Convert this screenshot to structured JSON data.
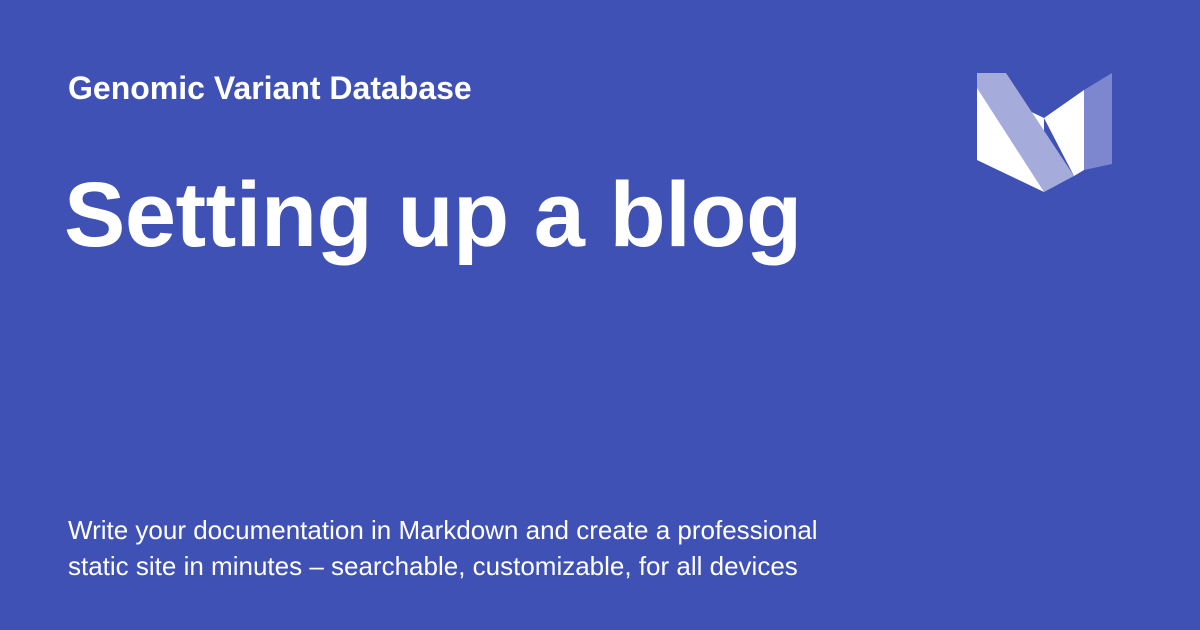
{
  "theme": {
    "background": "#3f51b5",
    "text": "#ffffff",
    "logo_light": "#ffffff",
    "logo_mid": "#a5acdc",
    "logo_dark": "#7c87cf"
  },
  "header": {
    "site_name": "Genomic Variant Database"
  },
  "main": {
    "title": "Setting up a blog"
  },
  "footer": {
    "description_line1": "Write your documentation in Markdown and create a professional",
    "description_line2": "static site in minutes – searchable, customizable, for all devices"
  },
  "logo": {
    "icon": "material-logo-icon"
  }
}
